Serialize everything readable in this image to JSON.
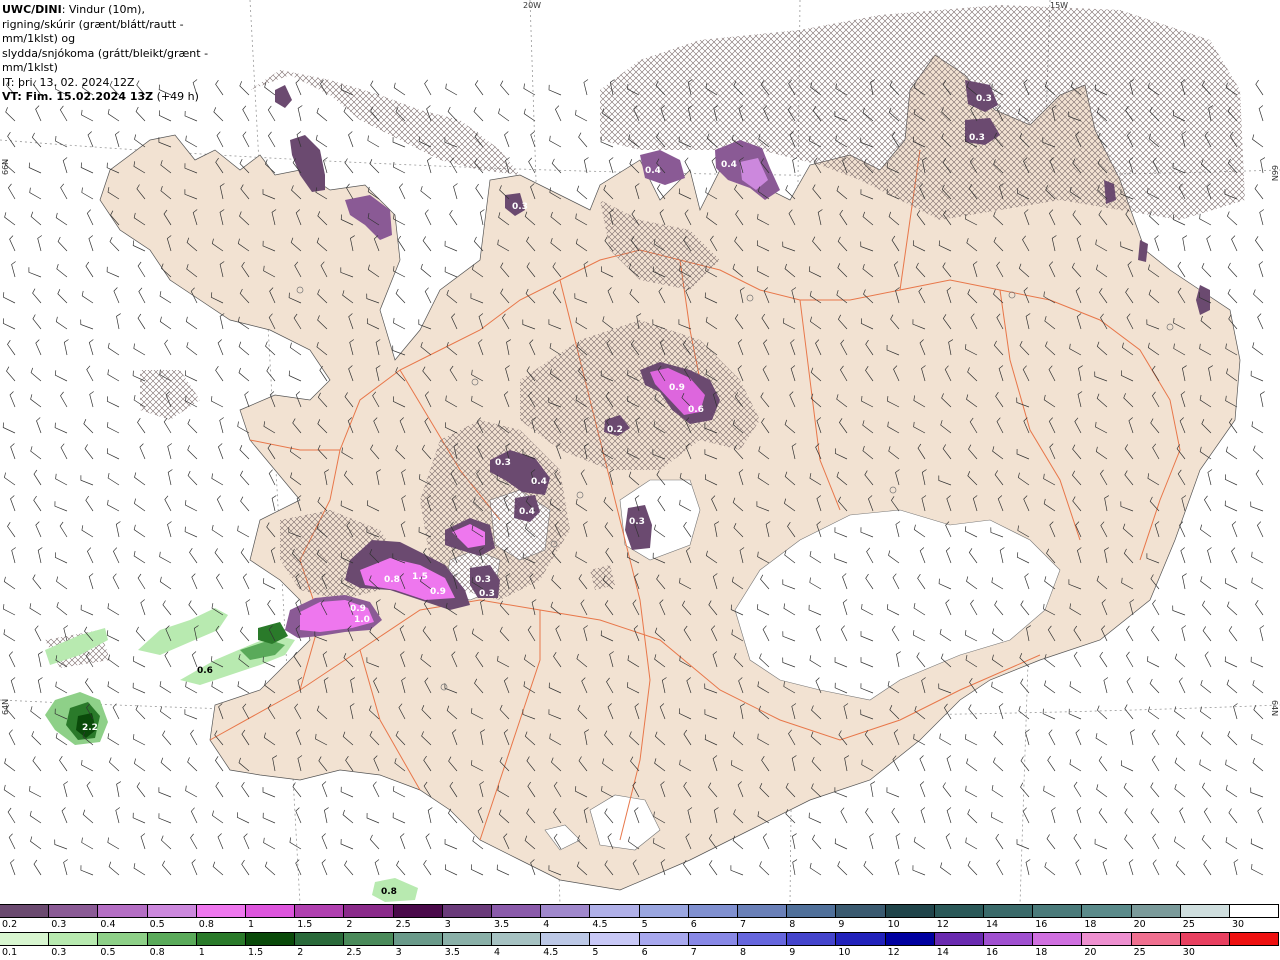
{
  "header": {
    "model": "UWC/DINI",
    "line1_rest": ": Vindur (10m),",
    "line2": "rigning/skúrir (grænt/blátt/rautt - mm/1klst) og",
    "line3": "slydda/snjókoma (grátt/bleikt/grænt - mm/1klst)",
    "line4": "IT: þri. 13. 02. 2024 12Z",
    "line5_bold": "VT: Fim. 15.02.2024 13Z",
    "line5_rest": " (+49 h)"
  },
  "grid_labels": {
    "lon_20w": "20W",
    "lon_15w": "15W",
    "lat_66n_left": "66N",
    "lat_66n_right": "66N",
    "lat_64n_left": "64N",
    "lat_64n_right": "64N"
  },
  "precip_values": [
    "0.3",
    "0.3",
    "0.4",
    "0.4",
    "0.3",
    "0.9",
    "0.6",
    "0.2",
    "0.3",
    "0.4",
    "0.4",
    "0.3",
    "1.5",
    "0.8",
    "0.9",
    "0.3",
    "0.3",
    "0.9",
    "1.0",
    "0.6",
    "2.2",
    "0.8"
  ],
  "snow_scale": {
    "labels": [
      "0.2",
      "0.3",
      "0.4",
      "0.5",
      "0.8",
      "1",
      "1.5",
      "2",
      "2.5",
      "3",
      "3.5",
      "4",
      "4.5",
      "5",
      "6",
      "7",
      "8",
      "9",
      "10",
      "12",
      "14",
      "16",
      "18",
      "20",
      "25",
      "30"
    ],
    "colors": [
      "#6b4a70",
      "#8a5a95",
      "#b46ec4",
      "#cc88dd",
      "#ee77ee",
      "#dd55dd",
      "#b040b0",
      "#8a2a8a",
      "#4a0a4a",
      "#6a3a7a",
      "#8a5aaa",
      "#a088cc",
      "#b0b0e8",
      "#9aa6e0",
      "#8090d0",
      "#6a80b8",
      "#50709a",
      "#3a5a70",
      "#20444a",
      "#2a5858",
      "#3a6a6a",
      "#4a7a7a",
      "#5a8a8a",
      "#7a9a9a",
      "#cfdede",
      "#ffffff"
    ]
  },
  "rain_scale": {
    "labels": [
      "0.1",
      "0.3",
      "0.5",
      "0.8",
      "1",
      "1.5",
      "2",
      "2.5",
      "3",
      "3.5",
      "4",
      "4.5",
      "5",
      "6",
      "7",
      "8",
      "9",
      "10",
      "12",
      "14",
      "16",
      "18",
      "20",
      "25",
      "30"
    ],
    "colors": [
      "#d8f6d0",
      "#b8eab0",
      "#8ed088",
      "#5aaa5a",
      "#2a7a2a",
      "#0a4a0a",
      "#2a6a3a",
      "#4a8a5a",
      "#6a9a8a",
      "#8ab0a8",
      "#a6c2c2",
      "#bcc8e6",
      "#c8c8f6",
      "#a8a8ee",
      "#8888e6",
      "#6666dd",
      "#4444cc",
      "#2222bb",
      "#0000a0",
      "#6a2ab0",
      "#a050d0",
      "#d070e0",
      "#ee90d0",
      "#f07090",
      "#e84060",
      "#ee1111"
    ]
  }
}
